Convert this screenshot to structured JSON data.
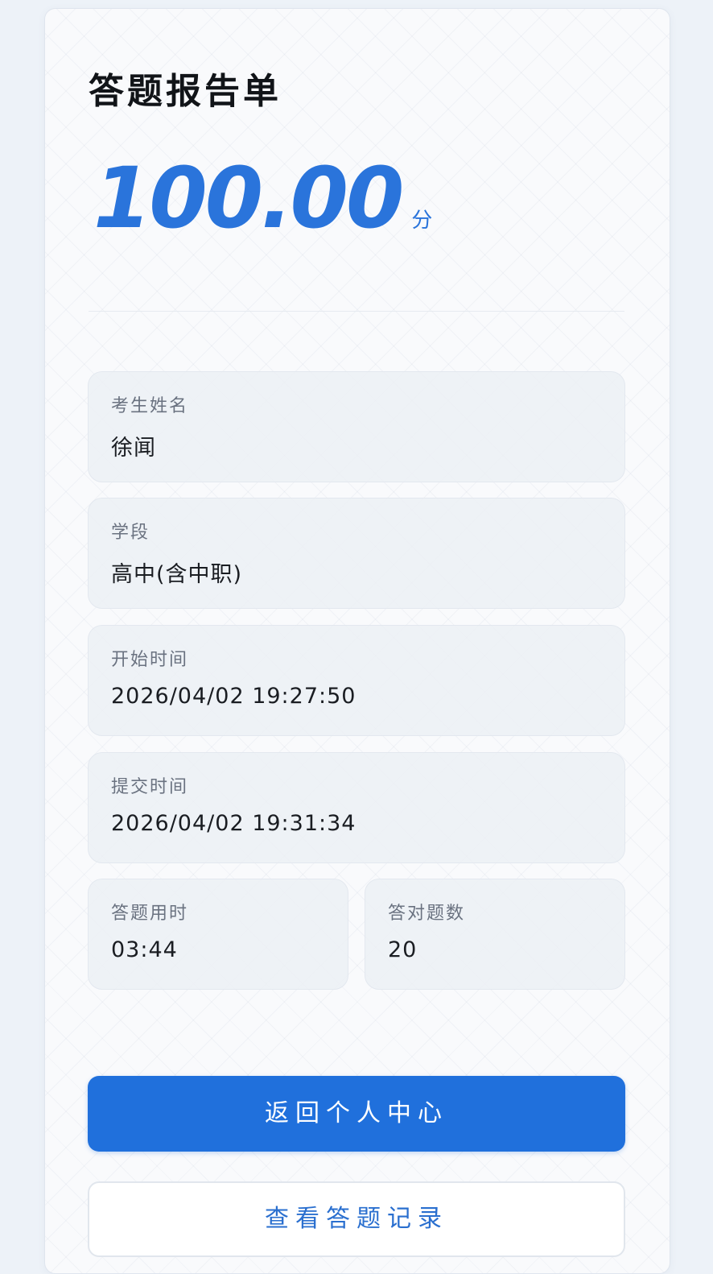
{
  "report": {
    "title": "答题报告单",
    "score": "100.00",
    "score_unit": "分"
  },
  "fields": {
    "name": {
      "label": "考生姓名",
      "value": "徐闻"
    },
    "stage": {
      "label": "学段",
      "value": "高中(含中职)"
    },
    "start": {
      "label": "开始时间",
      "value": "2026/04/02 19:27:50"
    },
    "submit": {
      "label": "提交时间",
      "value": "2026/04/02 19:31:34"
    },
    "duration": {
      "label": "答题用时",
      "value": "03:44"
    },
    "correct": {
      "label": "答对题数",
      "value": "20"
    }
  },
  "buttons": {
    "back": "返回个人中心",
    "records": "查看答题记录"
  },
  "colors": {
    "accent": "#2070dc",
    "score": "#2a74db",
    "background": "#edf2f8"
  }
}
